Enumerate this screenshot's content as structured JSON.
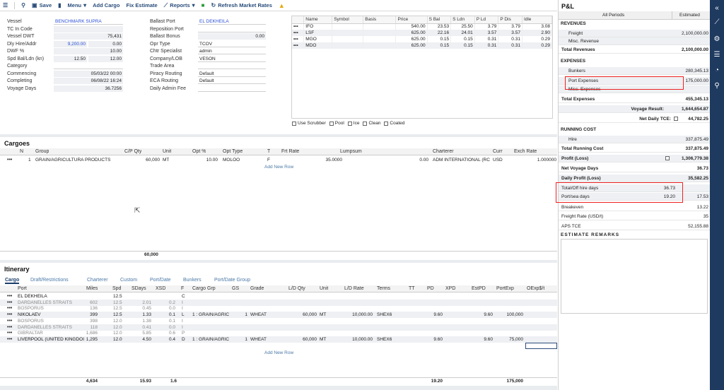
{
  "toolbar": {
    "save": "Save",
    "menu": "Menu",
    "add_cargo": "Add Cargo",
    "fix_estimate": "Fix Estimate",
    "reports": "Reports",
    "refresh": "Refresh Market Rates"
  },
  "voyage_form": {
    "col1": [
      {
        "label": "Vessel",
        "value": "BENCHMARK SUPRA"
      },
      {
        "label": "TC In Code",
        "value": ""
      },
      {
        "label": "Vessel DWT",
        "value": "75,431"
      },
      {
        "label": "Dly Hire/Addr",
        "value": "9,200.00",
        "value2": "0.00"
      },
      {
        "label": "DWF %",
        "value": "10.00"
      },
      {
        "label": "Spd Bal/Ldn (kn)",
        "value": "12.50",
        "value2": "12.00"
      },
      {
        "label": "Category",
        "value": ""
      },
      {
        "label": "Commencing",
        "value": "05/03/22 00:00"
      },
      {
        "label": "Completing",
        "value": "06/08/22 16:24"
      },
      {
        "label": "Voyage Days",
        "value": "36.7256"
      }
    ],
    "col2": [
      {
        "label": "Ballast Port",
        "value": "EL DEKHEILA"
      },
      {
        "label": "Reposition Port",
        "value": ""
      },
      {
        "label": "Ballast Bonus",
        "value": "0.00"
      },
      {
        "label": "Opr Type",
        "value": "TCOV"
      },
      {
        "label": "Chtr Specialist",
        "value": "admin"
      },
      {
        "label": "Company/LOB",
        "value": "VESON"
      },
      {
        "label": "Trade Area",
        "value": ""
      },
      {
        "label": "Piracy Routing",
        "value": "Default"
      },
      {
        "label": "ECA Routing",
        "value": "Default"
      },
      {
        "label": "Daily Admin Fee",
        "value": ""
      }
    ]
  },
  "fuel": {
    "headers": [
      "Name",
      "Symbol",
      "Basis",
      "Price",
      "S Bal",
      "S Ldn",
      "P Ld",
      "P Dis",
      "Idle"
    ],
    "rows": [
      [
        "IFO",
        "",
        "",
        "540.00",
        "23.53",
        "25.50",
        "3.79",
        "3.79",
        "3.08"
      ],
      [
        "LSF",
        "",
        "",
        "625.00",
        "22.16",
        "24.01",
        "3.57",
        "3.57",
        "2.90"
      ],
      [
        "MGO",
        "",
        "",
        "625.00",
        "0.15",
        "0.15",
        "0.31",
        "0.31",
        "0.29"
      ],
      [
        "MDO",
        "",
        "",
        "625.00",
        "0.15",
        "0.15",
        "0.31",
        "0.31",
        "0.29"
      ]
    ],
    "checks": [
      "Use Scrubber",
      "Pool",
      "Ice",
      "Clean",
      "Coated"
    ]
  },
  "cargoes": {
    "title": "Cargoes",
    "headers": [
      "N",
      "Group",
      "C/P Qty",
      "Unit",
      "Opt %",
      "Opt Type",
      "T",
      "Frt Rate",
      "Lumpsum",
      "Charterer",
      "Curr",
      "Exch Rate"
    ],
    "row": [
      "1",
      "GRAIN/AGRICULTURA PRODUCTS",
      "60,000",
      "MT",
      "10.00",
      "MOLOO",
      "F",
      "35.0000",
      "0.00",
      "ADM INTERNATIONAL (RC",
      "USD",
      "1.000000"
    ],
    "add_new": "Add New Row",
    "total_qty": "60,000"
  },
  "itinerary": {
    "title": "Itinerary",
    "tabs": [
      "Cargo",
      "Draft/Restrictions",
      "Charterer",
      "Custom",
      "Port/Date",
      "Bunkers",
      "Port/Date Group"
    ],
    "headers": [
      "Port",
      "Miles",
      "Spd",
      "SDays",
      "XSD",
      "F",
      "Cargo Grp",
      "GS",
      "Grade",
      "L/D Qty",
      "Unit",
      "L/D Rate",
      "Terms",
      "TT",
      "PD",
      "XPD",
      "EstPD",
      "PortExp",
      "OExp$/t"
    ],
    "rows": [
      {
        "port": "EL DEKHEILA",
        "miles": "",
        "spd": "12.5",
        "sdays": "",
        "xsd": "",
        "f": "C",
        "grp": "",
        "gs": "",
        "grade": "",
        "qty": "",
        "unit": "",
        "rate": "",
        "terms": "",
        "pd": "",
        "estpd": "",
        "portexp": "",
        "grey": false,
        "dots": true
      },
      {
        "port": "DARDANELLES STRAITS",
        "miles": "602",
        "spd": "12.5",
        "sdays": "2.01",
        "xsd": "0.2",
        "f": "I",
        "grp": "",
        "gs": "",
        "grade": "",
        "qty": "",
        "unit": "",
        "rate": "",
        "terms": "",
        "pd": "",
        "estpd": "",
        "portexp": "",
        "grey": true,
        "dots": true
      },
      {
        "port": "BOSPORUS",
        "miles": "136",
        "spd": "12.5",
        "sdays": "0.45",
        "xsd": "0.0",
        "f": "I",
        "grp": "",
        "gs": "",
        "grade": "",
        "qty": "",
        "unit": "",
        "rate": "",
        "terms": "",
        "pd": "",
        "estpd": "",
        "portexp": "",
        "grey": true,
        "dots": true
      },
      {
        "port": "NIKOLAEV",
        "miles": "399",
        "spd": "12.5",
        "sdays": "1.33",
        "xsd": "0.1",
        "f": "L",
        "grp": "1 : GRAIN/AGRIC",
        "gs": "1",
        "grade": "WHEAT",
        "qty": "60,000",
        "unit": "MT",
        "rate": "10,000.00",
        "terms": "SHEX6",
        "pd": "9.60",
        "estpd": "9.60",
        "portexp": "100,000",
        "grey": false,
        "dots": true
      },
      {
        "port": "BOSPORUS",
        "miles": "398",
        "spd": "12.0",
        "sdays": "1.38",
        "xsd": "0.1",
        "f": "I",
        "grp": "",
        "gs": "",
        "grade": "",
        "qty": "",
        "unit": "",
        "rate": "",
        "terms": "",
        "pd": "",
        "estpd": "",
        "portexp": "",
        "grey": true,
        "dots": true
      },
      {
        "port": "DARDANELLES STRAITS",
        "miles": "118",
        "spd": "12.0",
        "sdays": "0.41",
        "xsd": "0.0",
        "f": "I",
        "grp": "",
        "gs": "",
        "grade": "",
        "qty": "",
        "unit": "",
        "rate": "",
        "terms": "",
        "pd": "",
        "estpd": "",
        "portexp": "",
        "grey": true,
        "dots": true
      },
      {
        "port": "GIBRALTAR",
        "miles": "1,686",
        "spd": "12.0",
        "sdays": "5.85",
        "xsd": "0.6",
        "f": "P",
        "grp": "",
        "gs": "",
        "grade": "",
        "qty": "",
        "unit": "",
        "rate": "",
        "terms": "",
        "pd": "",
        "estpd": "",
        "portexp": "",
        "grey": true,
        "dots": true
      },
      {
        "port": "LIVERPOOL (UNITED KINGDOI",
        "miles": "1,295",
        "spd": "12.0",
        "sdays": "4.50",
        "xsd": "0.4",
        "f": "D",
        "grp": "1 : GRAIN/AGRIC",
        "gs": "1",
        "grade": "WHEAT",
        "qty": "60,000",
        "unit": "MT",
        "rate": "10,000.00",
        "terms": "SHEX6",
        "pd": "9.60",
        "estpd": "9.60",
        "portexp": "75,000",
        "grey": false,
        "dots": true
      }
    ],
    "add_new": "Add New Row",
    "totals": {
      "miles": "4,634",
      "sdays": "15.93",
      "xsd": "1.6",
      "pd": "19.20",
      "portexp": "175,000"
    }
  },
  "pl": {
    "title": "P&L",
    "col_periods": "All Periods",
    "col_estimated": "Estimated",
    "revenues": "REVENUES",
    "freight": {
      "label": "Freight",
      "value": "2,100,000.00"
    },
    "misc_revenue": {
      "label": "Misc. Revenue",
      "value": ""
    },
    "total_revenues": {
      "label": "Total Revenues",
      "value": "2,100,000.00"
    },
    "expenses": "EXPENSES",
    "bunkers": {
      "label": "Bunkers",
      "value": "280,345.13"
    },
    "port_expenses": {
      "label": "Port Expenses",
      "value": "175,000.00"
    },
    "misc_expenses": {
      "label": "Misc. Expenses",
      "value": ""
    },
    "total_expenses": {
      "label": "Total Expenses",
      "value": "455,345.13"
    },
    "voyage_result": {
      "label": "Voyage Result:",
      "value": "1,644,654.87"
    },
    "net_daily_tce": {
      "label": "Net Daily TCE:",
      "value": "44,782.25"
    },
    "running_cost": "RUNNING COST",
    "hire": {
      "label": "Hire",
      "value": "337,875.49"
    },
    "total_running_cost": {
      "label": "Total Running Cost",
      "value": "337,875.49"
    },
    "profit": {
      "label": "Profit (Loss)",
      "value": "1,306,779.38"
    },
    "net_voyage_days": {
      "label": "Net Voyage Days",
      "value": "36.73"
    },
    "daily_profit": {
      "label": "Daily Profit (Loss)",
      "value": "35,582.25"
    },
    "total_off_hire": {
      "label": "Total/Off hire days",
      "value": "36.73"
    },
    "port_sea_days": {
      "label": "Port/sea days",
      "value": "19.20",
      "value2": "17.53"
    },
    "breakeven": {
      "label": "Breakeven",
      "value": "13.22"
    },
    "freight_rate": {
      "label": "Freight Rate (USD/t)",
      "value": "35"
    },
    "aps_tce": {
      "label": "APS TCE",
      "value": "52,155.88"
    },
    "remarks": "ESTIMATE REMARKS"
  }
}
